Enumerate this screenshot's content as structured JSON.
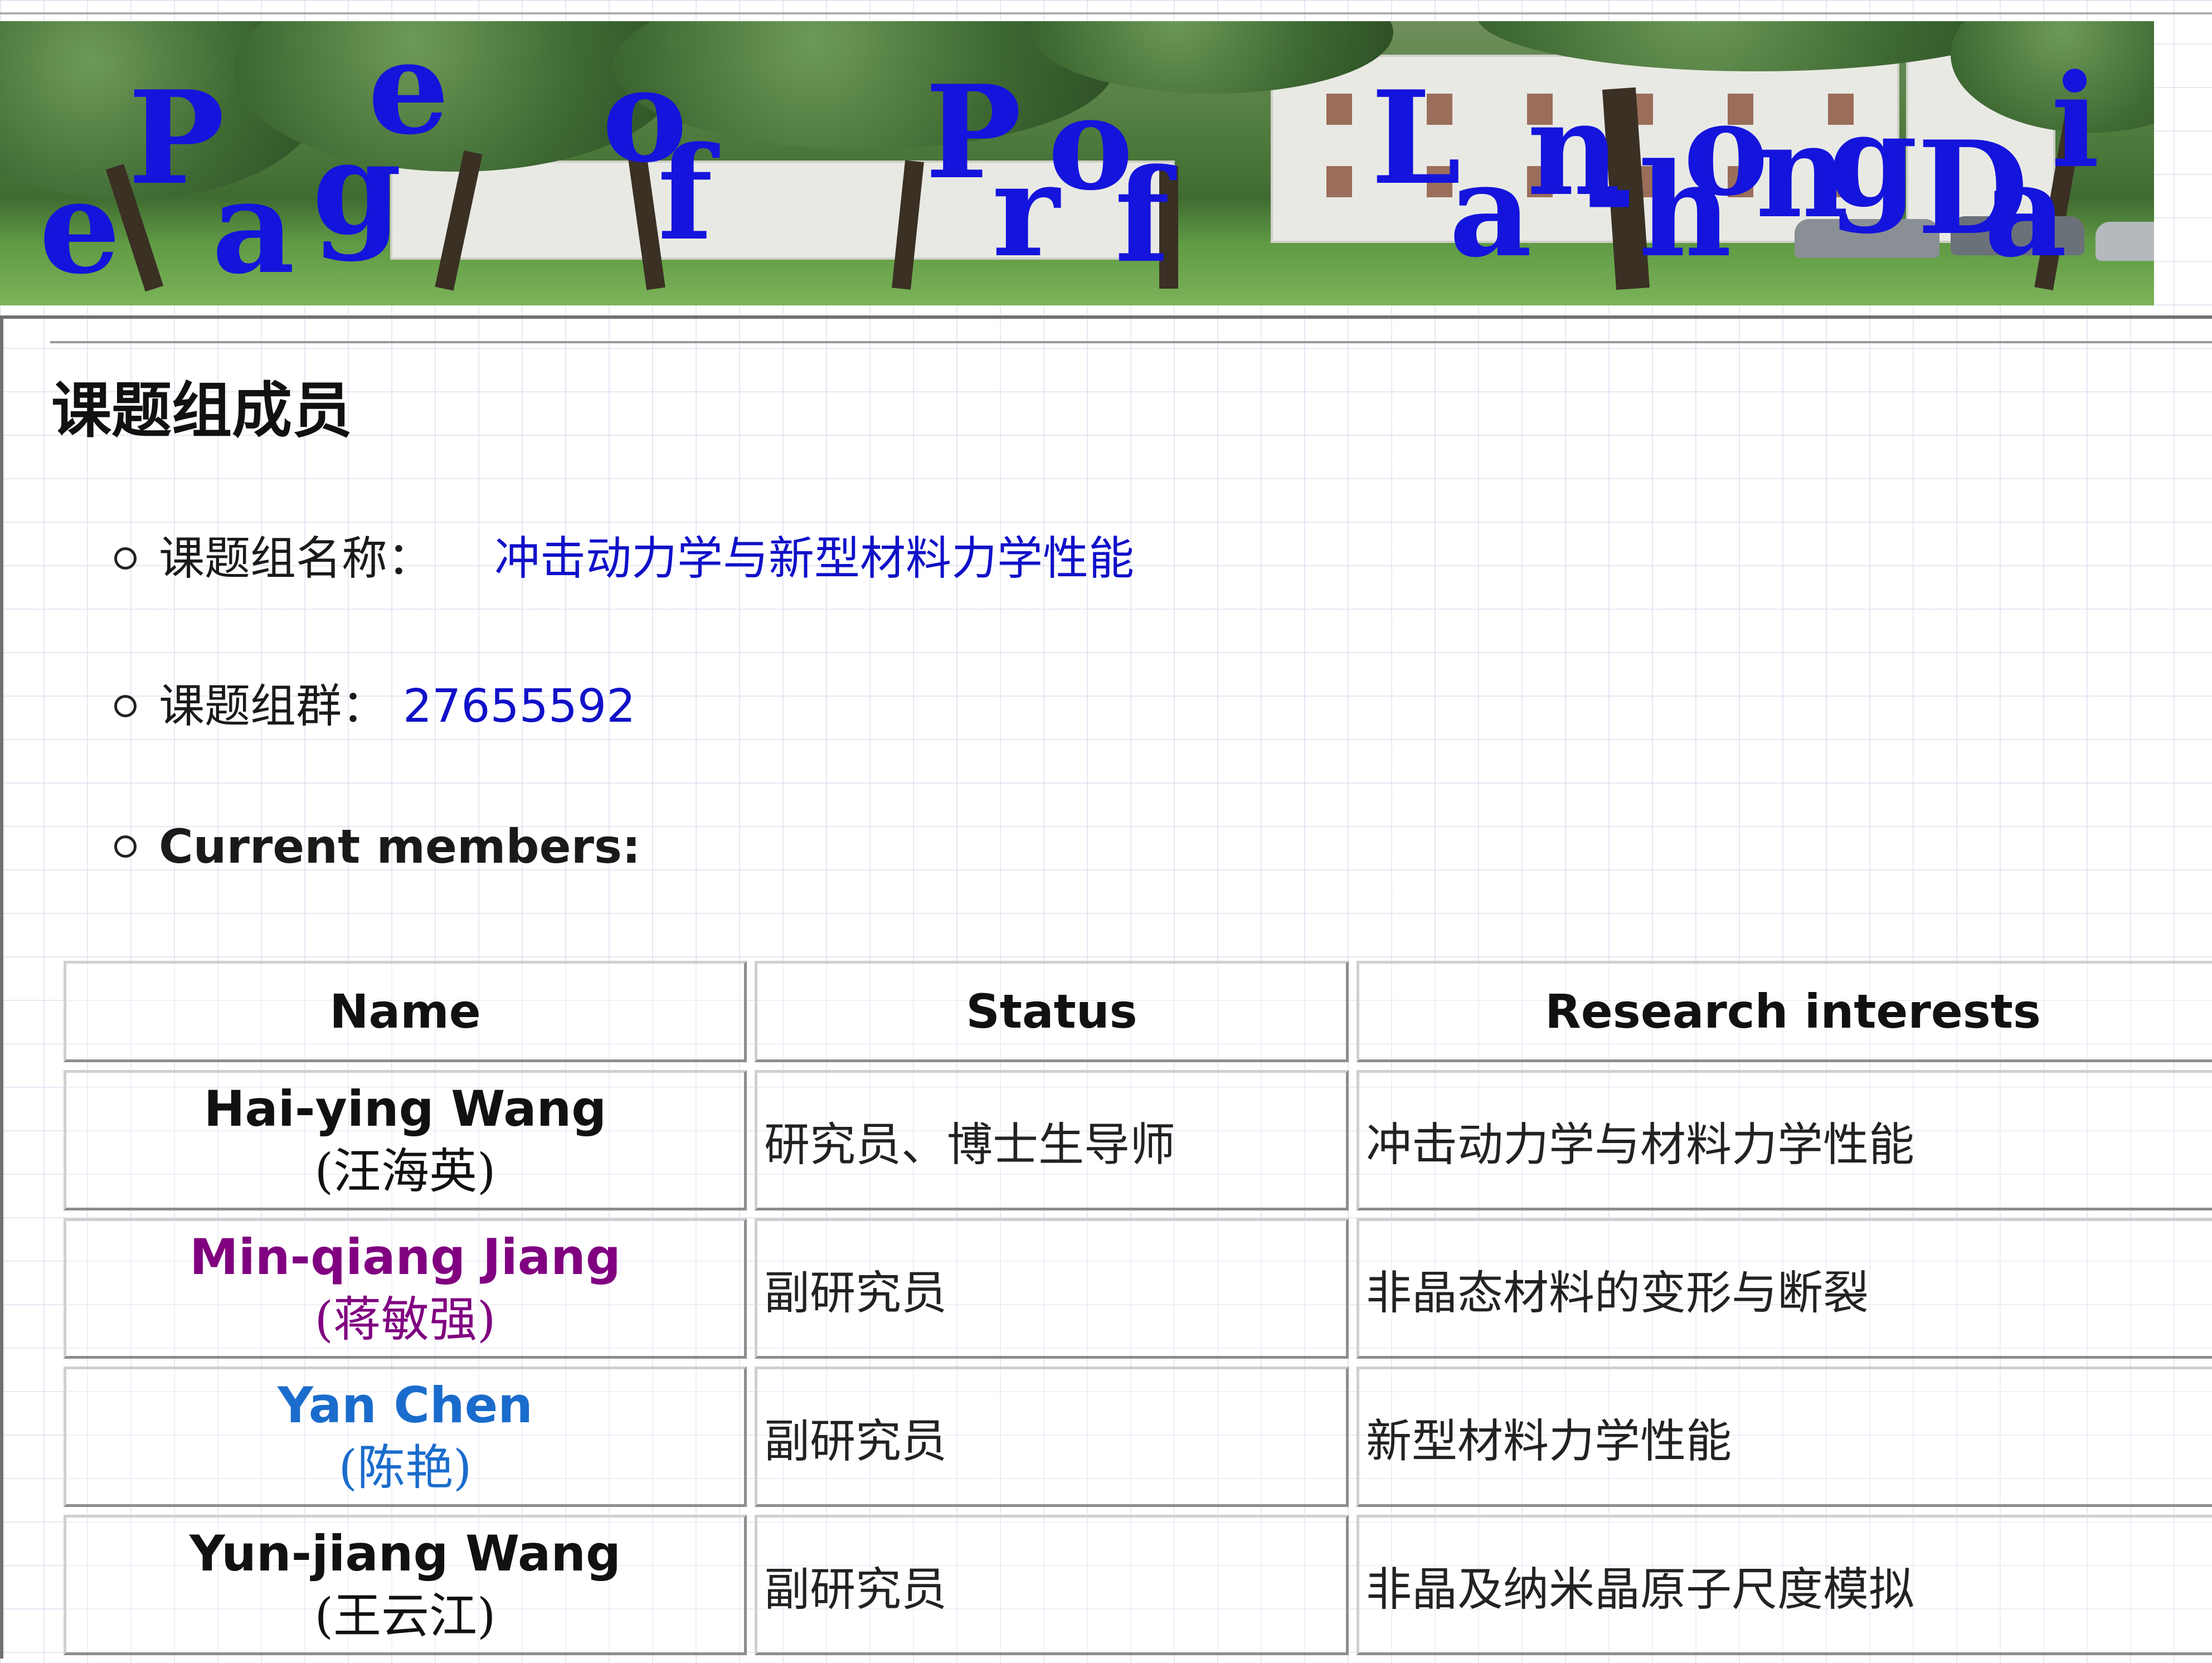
{
  "banner": {
    "title_letters": [
      "e",
      "P",
      "a",
      "g",
      "e",
      "o",
      "f",
      "P",
      "r",
      "o",
      "f",
      "L",
      "a",
      "n",
      "-",
      "h",
      "o",
      "n",
      "g",
      "D",
      "a",
      "i"
    ],
    "title_color": "#1414dc"
  },
  "page": {
    "title": "课题组成员",
    "group_name_label": "课题组名称：",
    "group_name_value": "冲击动力学与新型材料力学性能",
    "group_chat_label": "课题组群：",
    "group_chat_value": "27655592",
    "members_label": "Current members:"
  },
  "table": {
    "headers": [
      "Name",
      "Status",
      "Research interests"
    ],
    "rows": [
      {
        "name_en": "Hai-ying Wang",
        "name_cn": "(汪海英)",
        "name_color": "#111111",
        "status": "研究员、博士生导师",
        "interest": "冲击动力学与材料力学性能"
      },
      {
        "name_en": "Min-qiang Jiang",
        "name_cn": "(蒋敏强)",
        "name_color": "#800080",
        "status": "副研究员",
        "interest": "非晶态材料的变形与断裂"
      },
      {
        "name_en": "Yan Chen",
        "name_cn": "(陈艳)",
        "name_color": "#1a6ccc",
        "status": "副研究员",
        "interest": "新型材料力学性能"
      },
      {
        "name_en": "Yun-jiang Wang",
        "name_cn": "(王云江)",
        "name_color": "#111111",
        "status": "副研究员",
        "interest": "非晶及纳米晶原子尺度模拟"
      }
    ]
  }
}
